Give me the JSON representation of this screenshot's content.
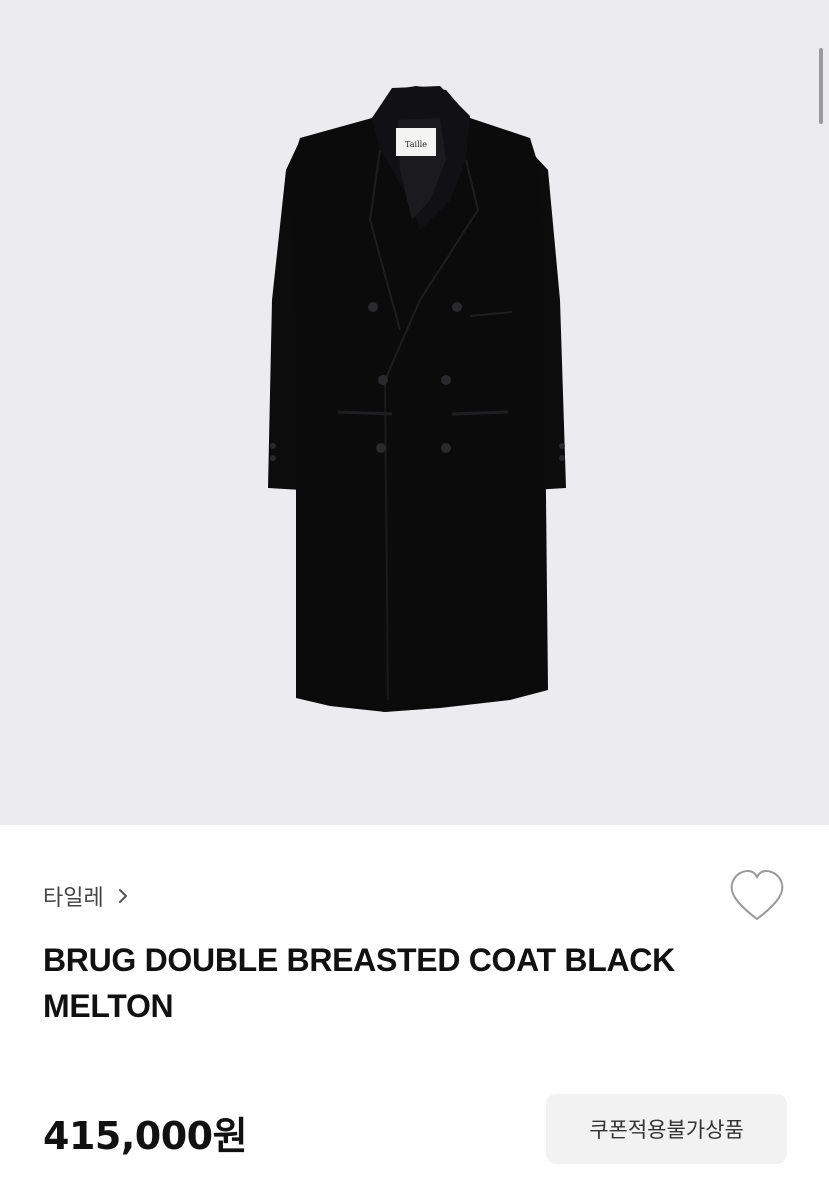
{
  "product": {
    "image_alt": "black double breasted wool coat",
    "label_text": "Taille",
    "brand": "타일레",
    "title": "BRUG DOUBLE BREASTED COAT BLACK MELTON",
    "price": "415,000원",
    "coupon_badge": "쿠폰적용불가상품"
  },
  "icons": {
    "brand_chevron": "chevron-right-icon",
    "wishlist": "heart-outline-icon"
  },
  "colors": {
    "hero_background": "#ececee",
    "coat": "#0b0b0c",
    "badge_background": "#f2f2f3"
  }
}
